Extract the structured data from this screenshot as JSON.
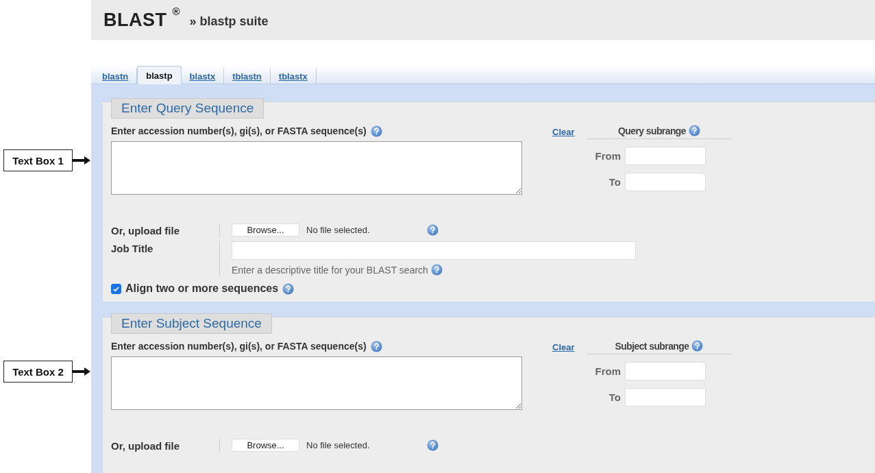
{
  "header": {
    "logo": "BLAST",
    "registered": "®",
    "separator": "»",
    "suite": "blastp suite"
  },
  "tabs": [
    {
      "label": "blastn",
      "selected": false
    },
    {
      "label": "blastp",
      "selected": true
    },
    {
      "label": "blastx",
      "selected": false
    },
    {
      "label": "tblastn",
      "selected": false
    },
    {
      "label": "tblastx",
      "selected": false
    }
  ],
  "sections": [
    {
      "legend": "Enter Query Sequence",
      "callout": "Text Box 1",
      "sequence_label": "Enter accession number(s), gi(s), or FASTA sequence(s)",
      "clear": "Clear",
      "subrange": {
        "title": "Query subrange",
        "from_label": "From",
        "to_label": "To"
      },
      "upload": {
        "label": "Or, upload file",
        "button": "Browse...",
        "status": "No file selected."
      },
      "job_title": {
        "label": "Job Title",
        "hint": "Enter a descriptive title for your BLAST search"
      },
      "align": {
        "label": "Align two or more sequences",
        "checked": true
      }
    },
    {
      "legend": "Enter Subject Sequence",
      "callout": "Text Box 2",
      "sequence_label": "Enter accession number(s), gi(s), or FASTA sequence(s)",
      "clear": "Clear",
      "subrange": {
        "title": "Subject subrange",
        "from_label": "From",
        "to_label": "To"
      },
      "upload": {
        "label": "Or, upload file",
        "button": "Browse...",
        "status": "No file selected."
      }
    }
  ]
}
